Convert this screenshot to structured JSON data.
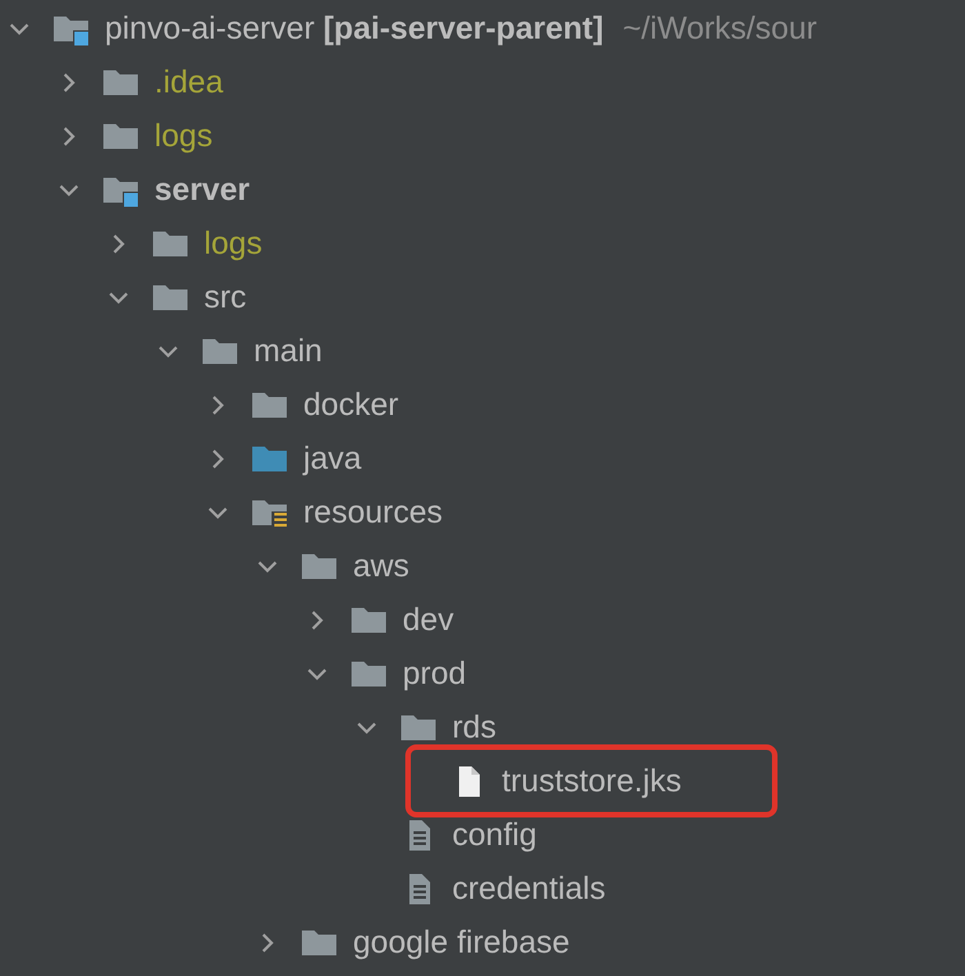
{
  "project_tree": {
    "label": "pinvo-ai-server **[pai-server-parent]**",
    "path": "~/iWorks/sour",
    "kind": "module",
    "expanded": true,
    "children": [
      {
        "label": ".idea",
        "kind": "folder",
        "ignored": true,
        "expanded": false
      },
      {
        "label": "logs",
        "kind": "folder",
        "ignored": true,
        "expanded": false
      },
      {
        "label": "server",
        "kind": "module",
        "bold": true,
        "expanded": true,
        "children": [
          {
            "label": "logs",
            "kind": "folder",
            "ignored": true,
            "expanded": false
          },
          {
            "label": "src",
            "kind": "folder",
            "expanded": true,
            "children": [
              {
                "label": "main",
                "kind": "folder",
                "expanded": true,
                "children": [
                  {
                    "label": "docker",
                    "kind": "folder",
                    "expanded": false
                  },
                  {
                    "label": "java",
                    "kind": "source",
                    "expanded": false
                  },
                  {
                    "label": "resources",
                    "kind": "resources",
                    "expanded": true,
                    "children": [
                      {
                        "label": "aws",
                        "kind": "folder",
                        "expanded": true,
                        "children": [
                          {
                            "label": "dev",
                            "kind": "folder",
                            "expanded": false
                          },
                          {
                            "label": "prod",
                            "kind": "folder",
                            "expanded": true,
                            "children": [
                              {
                                "label": "rds",
                                "kind": "folder",
                                "expanded": true,
                                "children": [
                                  {
                                    "label": "truststore.jks",
                                    "kind": "file",
                                    "highlighted": true
                                  }
                                ]
                              },
                              {
                                "label": "config",
                                "kind": "text",
                                "highlighted": false
                              },
                              {
                                "label": "credentials",
                                "kind": "text",
                                "highlighted": false
                              }
                            ]
                          }
                        ]
                      },
                      {
                        "label": "google firebase",
                        "kind": "folder",
                        "expanded": false
                      }
                    ]
                  }
                ]
              }
            ]
          }
        ]
      }
    ]
  }
}
